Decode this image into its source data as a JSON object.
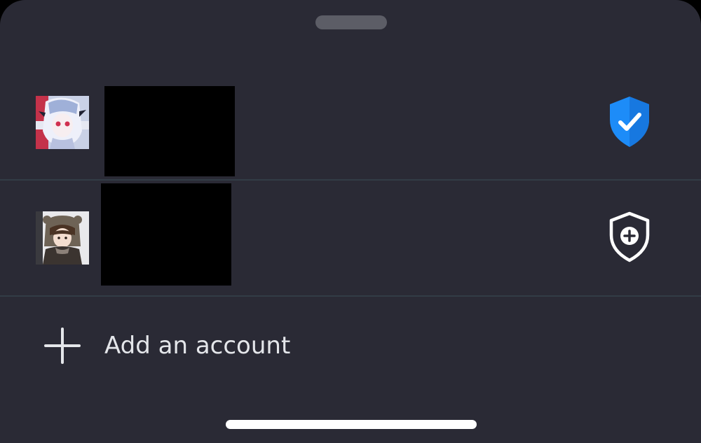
{
  "sheet": {
    "background": "#2a2a35",
    "divider_color": "#323c46"
  },
  "accounts": [
    {
      "avatar": "anime-avatar-white-hair",
      "name": "",
      "name_redacted": true,
      "status_icon": "shield-check-icon",
      "status_color": "#1d8cf8"
    },
    {
      "avatar": "anime-avatar-bear-hood",
      "name": "",
      "name_redacted": true,
      "status_icon": "shield-plus-icon",
      "status_color": "#ffffff"
    }
  ],
  "add_account": {
    "icon": "plus-icon",
    "label": "Add an account"
  }
}
